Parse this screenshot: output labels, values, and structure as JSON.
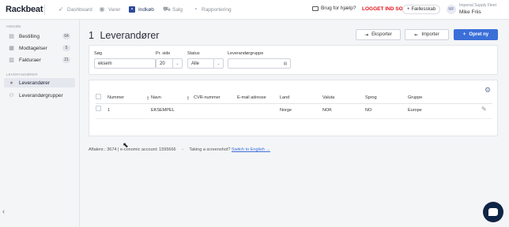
{
  "brand": {
    "name": "Rackbeat"
  },
  "nav": [
    {
      "label": "Dashboard",
      "icon": "rocket-icon",
      "active": false
    },
    {
      "label": "Varer",
      "icon": "box-icon",
      "active": false
    },
    {
      "label": "Indkøb",
      "icon": "purchase-icon",
      "active": true
    },
    {
      "label": "Salg",
      "icon": "cart-icon",
      "active": false
    },
    {
      "label": "Rapportering",
      "icon": "chart-icon",
      "active": false
    }
  ],
  "header": {
    "help": "Brug for hjælp?",
    "logged_in_as": "LOGGET IND SOM",
    "shared": "Fællesskab",
    "avatar_initials": "MF",
    "company": "Imperial Supply Fleet",
    "user": "Mike Friis"
  },
  "sidebar": {
    "section_purchase": "INDKØB",
    "purchase_items": [
      {
        "label": "Bestilling",
        "icon": "order-icon",
        "count": "64"
      },
      {
        "label": "Modtagelser",
        "icon": "receipt-icon",
        "count": "5"
      },
      {
        "label": "Fakturaer",
        "icon": "invoice-icon",
        "count": "21"
      }
    ],
    "section_suppliers": "LEVERANDØRER",
    "supplier_items": [
      {
        "label": "Leverandører",
        "icon": "user-icon",
        "active": true
      },
      {
        "label": "Leverandørgrupper",
        "icon": "users-icon",
        "active": false
      }
    ],
    "collapse": "‹"
  },
  "page": {
    "count": "1",
    "title": "Leverandører",
    "buttons": {
      "export": "Eksporter",
      "import": "Importer",
      "create": "Opret ny"
    }
  },
  "filters": {
    "search_label": "Søg",
    "search_value": "eksem",
    "per_page_label": "Pr. side",
    "per_page_value": "20",
    "status_label": "Status",
    "status_value": "Alle",
    "group_label": "Leverandørgruppe",
    "group_value": ""
  },
  "table": {
    "columns": [
      "Nummer",
      "Navn",
      "CVR-nummer",
      "E-mail adresse",
      "Land",
      "Valuta",
      "Sprog",
      "Gruppe"
    ],
    "rows": [
      {
        "number": "1",
        "name": "EKSEMPEL",
        "cvr": "",
        "email": "",
        "country": "Norge",
        "currency": "NOK",
        "language": "NO",
        "group": "Europe"
      }
    ]
  },
  "footer": {
    "agreement": "Aftalenr.: 3674 | e-conomic account: 1595666",
    "dash": "-",
    "screenshot": "Taking a screenshot?",
    "switch": "Switch to English →"
  }
}
